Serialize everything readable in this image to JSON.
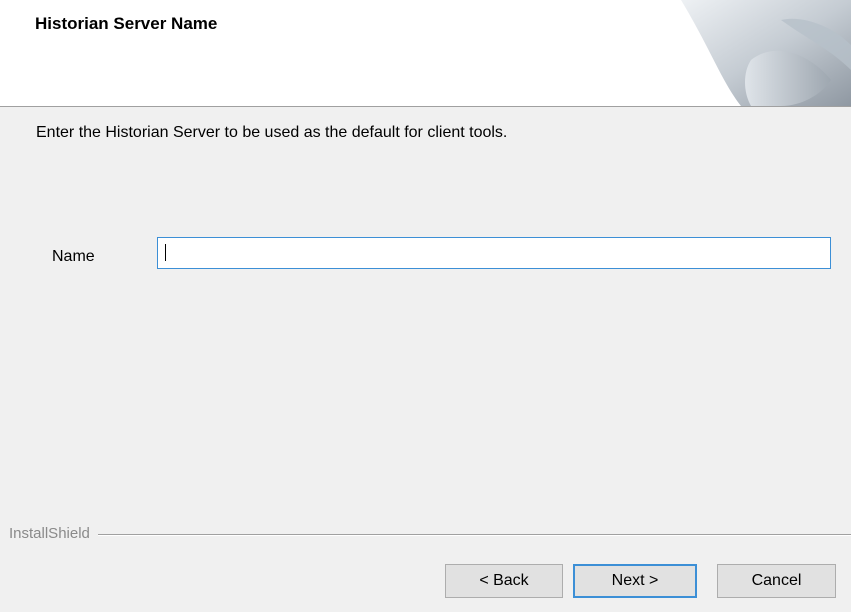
{
  "header": {
    "title": "Historian Server Name"
  },
  "body": {
    "instruction": "Enter the Historian Server to be used as the default for client tools.",
    "name_label": "Name",
    "name_value": ""
  },
  "footer": {
    "brand": "InstallShield",
    "back_label": "< Back",
    "next_label": "Next >",
    "cancel_label": "Cancel"
  },
  "colors": {
    "focus_accent": "#3c8fd6",
    "background": "#f0f0f0",
    "header_background": "#ffffff"
  },
  "icons": {
    "header_graphic": "page-curl-graphic"
  }
}
